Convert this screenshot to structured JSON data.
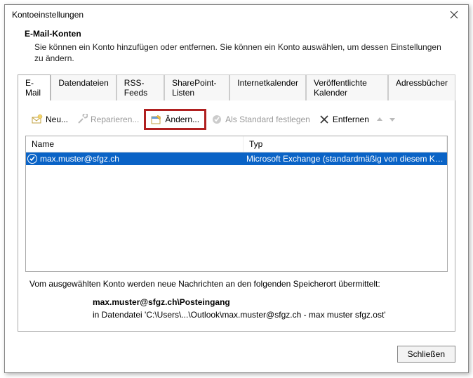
{
  "window": {
    "title": "Kontoeinstellungen"
  },
  "header": {
    "title": "E-Mail-Konten",
    "description": "Sie können ein Konto hinzufügen oder entfernen. Sie können ein Konto auswählen, um dessen Einstellungen zu ändern."
  },
  "tabs": {
    "email": "E-Mail",
    "datafiles": "Datendateien",
    "rss": "RSS-Feeds",
    "sharepoint": "SharePoint-Listen",
    "ical": "Internetkalender",
    "pubcal": "Veröffentlichte Kalender",
    "addr": "Adressbücher"
  },
  "toolbar": {
    "new": "Neu...",
    "repair": "Reparieren...",
    "change": "Ändern...",
    "default": "Als Standard festlegen",
    "remove": "Entfernen"
  },
  "list": {
    "col_name": "Name",
    "col_type": "Typ",
    "rows": [
      {
        "name": "max.muster@sfgz.ch",
        "type": "Microsoft Exchange (standardmäßig von diesem Kon..."
      }
    ]
  },
  "footer": {
    "label": "Vom ausgewählten Konto werden neue Nachrichten an den folgenden Speicherort übermittelt:",
    "location_bold": "max.muster@sfgz.ch\\Posteingang",
    "location_path": "in Datendatei 'C:\\Users\\...\\Outlook\\max.muster@sfgz.ch - max muster sfgz.ost'"
  },
  "buttons": {
    "close": "Schließen"
  }
}
